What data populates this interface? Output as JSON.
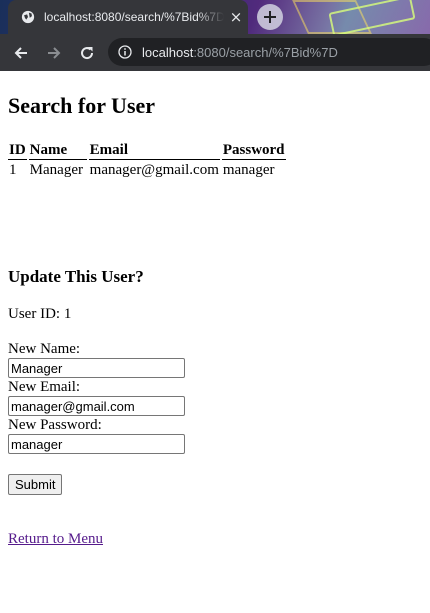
{
  "browser": {
    "tab_title": "localhost:8080/search/%7Bid%7D",
    "tab_close": "×",
    "new_tab": "+",
    "url_host": "localhost",
    "url_rest": ":8080/search/%7Bid%7D",
    "accent": "#35363a"
  },
  "page": {
    "title": "Search for User",
    "table": {
      "headers": [
        "ID",
        "Name",
        "Email",
        "Password"
      ],
      "rows": [
        [
          "1",
          "Manager",
          "manager@gmail.com",
          "manager"
        ]
      ]
    },
    "update_heading": "Update This User?",
    "user_id_text": "User ID: 1",
    "form": {
      "name_label": "New Name:",
      "name_value": "Manager",
      "email_label": "New Email:",
      "email_value": "manager@gmail.com",
      "password_label": "New Password:",
      "password_value": "manager",
      "submit_label": "Submit"
    },
    "return_link": "Return to Menu",
    "link_color": "#551a8b"
  }
}
